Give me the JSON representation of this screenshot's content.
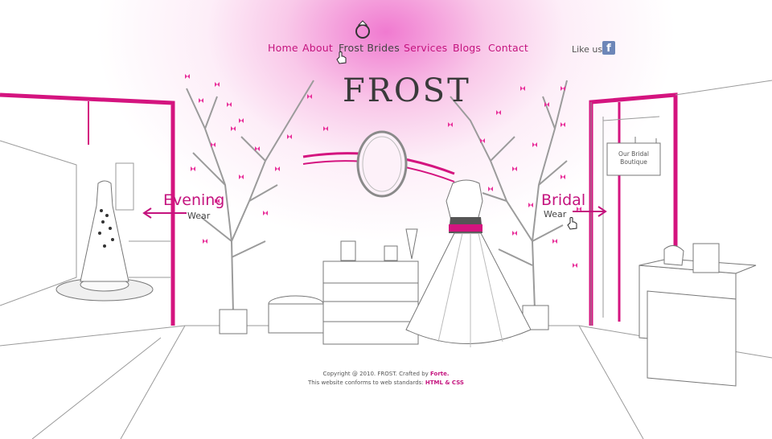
{
  "nav": {
    "items": [
      {
        "label": "Home"
      },
      {
        "label": "About"
      },
      {
        "label": "Frost Brides"
      },
      {
        "label": "Services"
      },
      {
        "label": "Blogs"
      },
      {
        "label": "Contact"
      }
    ],
    "active_index": 2
  },
  "social": {
    "like_us": "Like us",
    "facebook_glyph": "f"
  },
  "logo": {
    "text": "FROST"
  },
  "sign": {
    "line1": "Our Bridal",
    "line2": "Boutique"
  },
  "sections": {
    "evening": {
      "title": "Evening",
      "subtitle": "Wear"
    },
    "bridal": {
      "title": "Bridal",
      "subtitle": "Wear"
    }
  },
  "footer": {
    "line1_prefix": "Copyright @ 2010. FROST. Crafted by",
    "line1_link": "Forte.",
    "line2_prefix": "This website conforms to web standards:",
    "line2_link": "HTML & CSS"
  },
  "colors": {
    "accent": "#c4137e",
    "butterfly": "#e8309a",
    "sketch": "#8a8a8a",
    "fb_blue": "#6d86b8"
  },
  "icons": {
    "ring": "ring-icon",
    "cursor": "hand-cursor-icon",
    "facebook": "facebook-icon"
  }
}
